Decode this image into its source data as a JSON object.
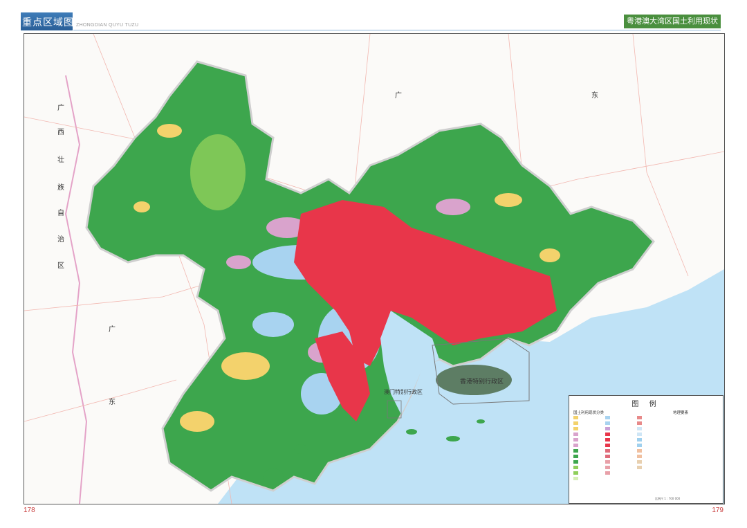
{
  "header": {
    "section_title": "重点区域图组",
    "section_pinyin": "ZHONGDIAN QUYU TUZU",
    "map_title": "粤港澳大湾区国土利用现状"
  },
  "pages": {
    "left": "178",
    "right": "179"
  },
  "map_labels": {
    "guangxi_1": "广",
    "guangxi_2": "西",
    "guangxi_3": "壮",
    "guangxi_4": "族",
    "guangxi_5": "自",
    "guangxi_6": "治",
    "guangxi_7": "区",
    "guangdong_left_1": "广",
    "guangdong_left_2": "东",
    "guangdong_top_1": "广",
    "guangdong_top_2": "东",
    "hong_kong": "香港特别行政区",
    "macau": "澳门特别行政区"
  },
  "legend": {
    "title": "图 例",
    "section_land_use": "国土利用现状分类",
    "section_geo": "地理要素",
    "scale": "比例尺 1 : 700 000",
    "colors": {
      "forest": "#3da64d",
      "urban": "#e8364a",
      "water": "#a8d3f0",
      "farmland": "#f3d26c",
      "garden": "#d9a3cc",
      "industrial": "#c9a0d6",
      "grass": "#8fcf5a"
    }
  }
}
